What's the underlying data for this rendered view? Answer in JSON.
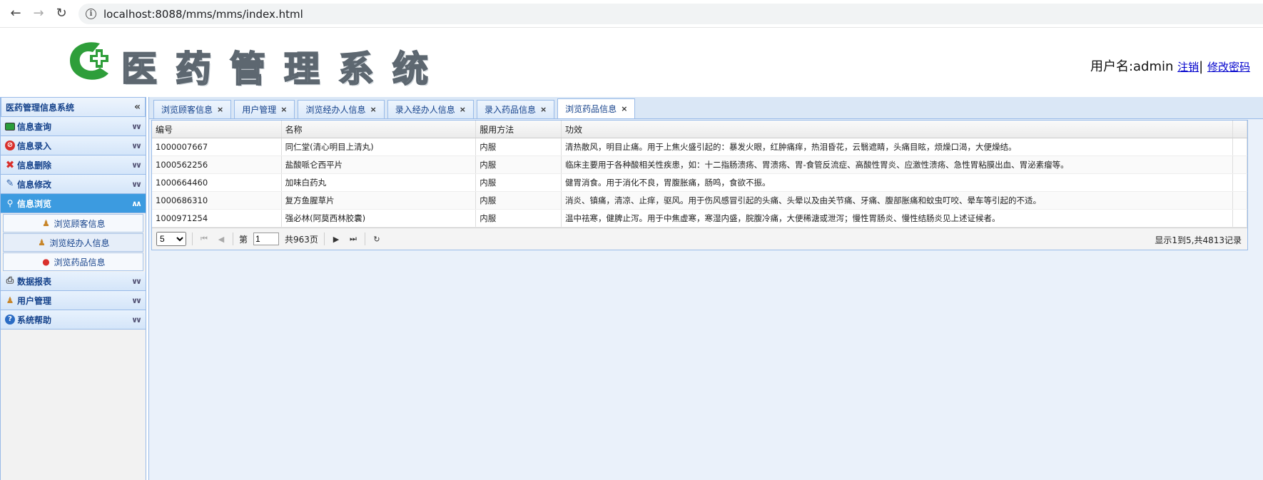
{
  "browser": {
    "url": "localhost:8088/mms/mms/index.html",
    "back_icon": "arrow-left-icon",
    "forward_icon": "arrow-right-icon",
    "reload_icon": "reload-icon"
  },
  "header": {
    "title": "医药管理系统",
    "user_label": "用户名:admin",
    "logout_label": "注销",
    "separator": "|",
    "change_password_label": "修改密码",
    "brand_colors": {
      "green": "#2e9e3a",
      "gray": "#9aa4ad"
    }
  },
  "sidebar": {
    "title": "医药管理信息系统",
    "collapse_icon": "double-chevron-left-icon",
    "items": [
      {
        "label": "信息查询",
        "icon": "monitor-icon",
        "active": false
      },
      {
        "label": "信息录入",
        "icon": "no-entry-icon",
        "active": false
      },
      {
        "label": "信息删除",
        "icon": "red-x-icon",
        "active": false
      },
      {
        "label": "信息修改",
        "icon": "pencil-icon",
        "active": false
      },
      {
        "label": "信息浏览",
        "icon": "magnifier-icon",
        "active": true
      },
      {
        "label": "数据报表",
        "icon": "printer-icon",
        "active": false
      },
      {
        "label": "用户管理",
        "icon": "user-icon",
        "active": false
      },
      {
        "label": "系统帮助",
        "icon": "help-icon",
        "active": false
      }
    ],
    "sub_items": [
      {
        "label": "浏览顾客信息",
        "icon": "customer-icon"
      },
      {
        "label": "浏览经办人信息",
        "icon": "agent-icon"
      },
      {
        "label": "浏览药品信息",
        "icon": "medicine-icon"
      }
    ]
  },
  "tabs": [
    {
      "label": "浏览顾客信息",
      "active": false
    },
    {
      "label": "用户管理",
      "active": false
    },
    {
      "label": "浏览经办人信息",
      "active": false
    },
    {
      "label": "录入经办人信息",
      "active": false
    },
    {
      "label": "录入药品信息",
      "active": false
    },
    {
      "label": "浏览药品信息",
      "active": true
    }
  ],
  "tab_close": "×",
  "grid": {
    "columns": [
      "编号",
      "名称",
      "服用方法",
      "功效"
    ],
    "rows": [
      [
        "1000007667",
        "同仁堂(清心明目上清丸)",
        "内服",
        "清热散风，明目止痛。用于上焦火盛引起的：暴发火眼，红肿痛痒，热泪昏花，云翳遮睛，头痛目眩，烦燥口渴，大便燥结。"
      ],
      [
        "1000562256",
        "盐酸哌仑西平片",
        "内服",
        "临床主要用于各种酸相关性疾患，如：十二指肠溃疡、胃溃疡、胃-食管反流症、高酸性胃炎、应激性溃疡、急性胃粘膜出血、胃泌素瘤等。"
      ],
      [
        "1000664460",
        "加味白药丸",
        "内服",
        "健胃消食。用于消化不良，胃腹胀痛，肠鸣，食欲不振。"
      ],
      [
        "1000686310",
        "复方鱼腥草片",
        "内服",
        "消炎、镇痛，清凉、止痒，驱风。用于伤风感冒引起的头痛、头晕以及由关节痛、牙痛、腹部胀痛和蚊虫叮咬、晕车等引起的不适。"
      ],
      [
        "1000971254",
        "强必林(阿莫西林胶囊)",
        "内服",
        "温中祛寒，健脾止泻。用于中焦虚寒，寒湿内盛，脘腹冷痛，大便稀溏或泄泻；慢性胃肠炎、慢性结肠炎见上述证候者。"
      ]
    ]
  },
  "pager": {
    "page_size": "5",
    "page_prefix": "第",
    "current_page": "1",
    "total_pages": "共963页",
    "summary": "显示1到5,共4813记录"
  }
}
